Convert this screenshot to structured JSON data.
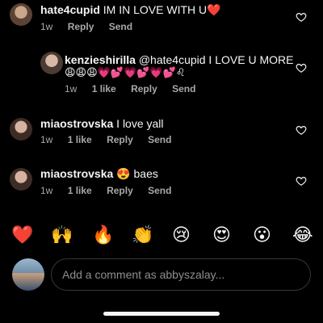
{
  "comments": [
    {
      "username": "hate4cupid",
      "text": "IM IN LOVE WITH U❤️",
      "time": "1w",
      "likes": "",
      "reply": "Reply",
      "send": "Send"
    },
    {
      "username": "kenzieshirilla",
      "text": "@hate4cupid I LOVE U MORE",
      "text2": "😩😩😩💗💕💗💕💗💕♌",
      "time": "1w",
      "likes": "1 like",
      "reply": "Reply",
      "send": "Send"
    },
    {
      "username": "miaostrovska",
      "text": "I love yall",
      "time": "1w",
      "likes": "1 like",
      "reply": "Reply",
      "send": "Send"
    },
    {
      "username": "miaostrovska",
      "text": "😍 baes",
      "time": "1w",
      "likes": "1 like",
      "reply": "Reply",
      "send": "Send"
    }
  ],
  "quick_reactions": [
    "❤️",
    "🙌",
    "🔥",
    "👏",
    "😢",
    "😍",
    "😮",
    "😂"
  ],
  "composer": {
    "placeholder": "Add a comment as abbyszalay..."
  },
  "colors": {
    "background": "#000000",
    "text": "#f5f5f5",
    "muted": "#a8a8a8",
    "border": "#363636"
  }
}
